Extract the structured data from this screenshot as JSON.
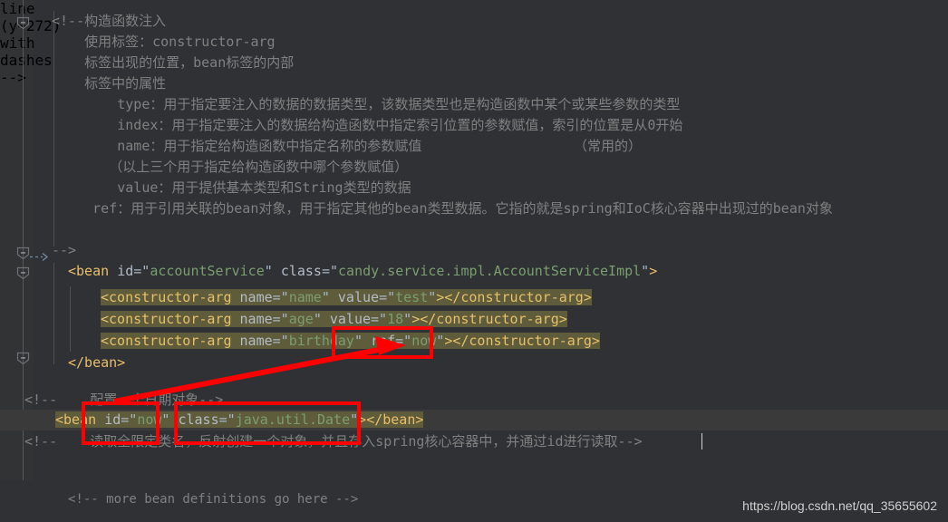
{
  "app": {
    "type": "code-editor",
    "language": "xml",
    "theme": "darcula",
    "background": "#2f3134",
    "gutter_background": "#313335",
    "highlight_background": "#5e5c3a",
    "annotation_color": "#ff0000"
  },
  "code_lines": [
    {
      "id": "l1",
      "indent": 0,
      "text": "<!--构造函数注入",
      "kind": "comment"
    },
    {
      "id": "l2",
      "indent": 0,
      "text": "    使用标签：constructor-arg",
      "kind": "comment"
    },
    {
      "id": "l3",
      "indent": 0,
      "text": "    标签出现的位置，bean标签的内部",
      "kind": "comment"
    },
    {
      "id": "l4",
      "indent": 0,
      "text": "    标签中的属性",
      "kind": "comment"
    },
    {
      "id": "l5",
      "indent": 0,
      "text": "        type：用于指定要注入的数据的数据类型，该数据类型也是构造函数中某个或某些参数的类型",
      "kind": "comment"
    },
    {
      "id": "l6",
      "indent": 0,
      "text": "        index：用于指定要注入的数据给构造函数中指定索引位置的参数赋值，索引的位置是从0开始",
      "kind": "comment"
    },
    {
      "id": "l7",
      "indent": 0,
      "text": "        name：用于指定给构造函数中指定名称的参数赋值",
      "kind": "comment",
      "trailing": "（常用的）"
    },
    {
      "id": "l8",
      "indent": 0,
      "text": "       （以上三个用于指定给构造函数中哪个参数赋值）",
      "kind": "comment"
    },
    {
      "id": "l9",
      "indent": 0,
      "text": "        value：用于提供基本类型和String类型的数据",
      "kind": "comment"
    },
    {
      "id": "l10",
      "indent": 0,
      "text": "     ref：用于引用关联的bean对象，用于指定其他的bean类型数据。它指的就是spring和IoC核心容器中出现过的bean对象",
      "kind": "comment"
    },
    {
      "id": "l11",
      "indent": 0,
      "text": "-->",
      "kind": "comment"
    }
  ],
  "bean_block": {
    "open_tag": {
      "lt": "<",
      "name": "bean",
      "attrs": [
        {
          "name": "id",
          "value": "accountService"
        },
        {
          "name": "class",
          "value": "candy.service.impl.AccountServiceImpl"
        }
      ],
      "gt": ">"
    },
    "children": [
      {
        "name": "constructor-arg",
        "attrs": [
          {
            "name": "name",
            "value": "name"
          },
          {
            "name": "value",
            "value": "test"
          }
        ],
        "close": "</constructor-arg>"
      },
      {
        "name": "constructor-arg",
        "attrs": [
          {
            "name": "name",
            "value": "age"
          },
          {
            "name": "value",
            "value": "18"
          }
        ],
        "close": "</constructor-arg>"
      },
      {
        "name": "constructor-arg",
        "attrs": [
          {
            "name": "name",
            "value": "birthday"
          },
          {
            "name": "ref",
            "value": "now"
          }
        ],
        "close": "</constructor-arg>"
      }
    ],
    "close_tag": "</bean>"
  },
  "date_bean": {
    "comment_above": "<!--    配置一个日期对象-->",
    "tag": {
      "lt": "<",
      "name": "bean",
      "attrs": [
        {
          "name": "id",
          "value": "now"
        },
        {
          "name": "class",
          "value": "java.util.Date"
        }
      ],
      "gt": ">",
      "close": "</bean>"
    },
    "comment_below": "<!--    读取全限定类名，反射创建一个对象，并且存入spring核心容器中，并通过id进行读取-->"
  },
  "footer_comment": "<!-- more bean definitions go here -->",
  "watermark": "https://blog.csdn.net/qq_35655602",
  "gutter": {
    "fold_markers": [
      "collapse-fold-1",
      "collapse-fold-2",
      "collapse-fold-3",
      "collapse-fold-4"
    ],
    "bulb": "intention-bulb"
  }
}
